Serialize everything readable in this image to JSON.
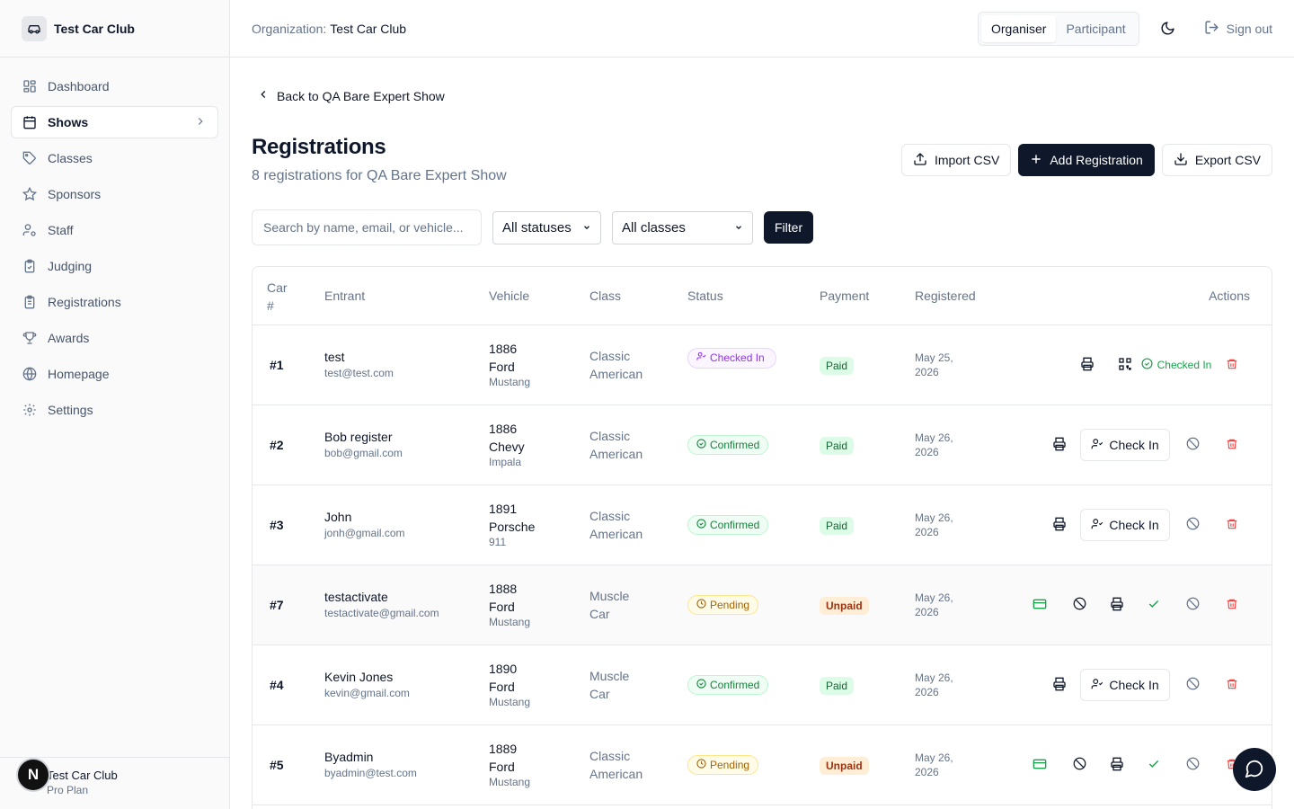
{
  "brand": {
    "name": "Test Car Club",
    "icon": "car-icon"
  },
  "sidebar": {
    "items": [
      {
        "label": "Dashboard",
        "icon": "dashboard-icon"
      },
      {
        "label": "Shows",
        "icon": "calendar-icon",
        "active": true
      },
      {
        "label": "Classes",
        "icon": "tag-icon"
      },
      {
        "label": "Sponsors",
        "icon": "star-icon"
      },
      {
        "label": "Staff",
        "icon": "user-cog-icon"
      },
      {
        "label": "Judging",
        "icon": "clipboard-check-icon"
      },
      {
        "label": "Registrations",
        "icon": "clipboard-list-icon"
      },
      {
        "label": "Awards",
        "icon": "trophy-icon"
      },
      {
        "label": "Homepage",
        "icon": "globe-icon"
      },
      {
        "label": "Settings",
        "icon": "gear-icon"
      }
    ],
    "footer": {
      "org": "Test Car Club",
      "plan": "Pro Plan",
      "avatar_letter": "N"
    }
  },
  "header": {
    "org_label": "Organization:",
    "org_value": "Test Car Club",
    "modes": [
      "Organiser",
      "Participant"
    ],
    "active_mode": "Organiser",
    "signout": "Sign out"
  },
  "page": {
    "back_label": "Back to QA Bare Expert Show",
    "title": "Registrations",
    "subtitle": "8 registrations for QA Bare Expert Show",
    "import_label": "Import CSV",
    "add_label": "Add Registration",
    "export_label": "Export CSV"
  },
  "filters": {
    "search_placeholder": "Search by name, email, or vehicle...",
    "status_value": "All statuses",
    "class_value": "All classes",
    "filter_label": "Filter"
  },
  "table": {
    "headers": {
      "car_line1": "Car",
      "car_line2": "#",
      "entrant": "Entrant",
      "vehicle": "Vehicle",
      "class": "Class",
      "status": "Status",
      "payment": "Payment",
      "registered": "Registered",
      "actions": "Actions"
    },
    "rows": [
      {
        "car": "#1",
        "name": "test",
        "email": "test@test.com",
        "year": "1886",
        "make": "Ford",
        "model": "Mustang",
        "class1": "Classic",
        "class2": "American",
        "status": "Checked In",
        "payment": "Paid",
        "date1": "May 25,",
        "date2": "2026",
        "checked_label": "Checked In"
      },
      {
        "car": "#2",
        "name": "Bob register",
        "email": "bob@gmail.com",
        "year": "1886",
        "make": "Chevy",
        "model": "Impala",
        "class1": "Classic",
        "class2": "American",
        "status": "Confirmed",
        "payment": "Paid",
        "date1": "May 26,",
        "date2": "2026",
        "checkin_label": "Check In"
      },
      {
        "car": "#3",
        "name": "John",
        "email": "jonh@gmail.com",
        "year": "1891",
        "make": "Porsche",
        "model": "911",
        "class1": "Classic",
        "class2": "American",
        "status": "Confirmed",
        "payment": "Paid",
        "date1": "May 26,",
        "date2": "2026",
        "checkin_label": "Check In"
      },
      {
        "car": "#7",
        "name": "testactivate",
        "email": "testactivate@gmail.com",
        "year": "1888",
        "make": "Ford",
        "model": "Mustang",
        "class1": "Muscle",
        "class2": "Car",
        "status": "Pending",
        "payment": "Unpaid",
        "date1": "May 26,",
        "date2": "2026"
      },
      {
        "car": "#4",
        "name": "Kevin Jones",
        "email": "kevin@gmail.com",
        "year": "1890",
        "make": "Ford",
        "model": "Mustang",
        "class1": "Muscle",
        "class2": "Car",
        "status": "Confirmed",
        "payment": "Paid",
        "date1": "May 26,",
        "date2": "2026",
        "checkin_label": "Check In"
      },
      {
        "car": "#5",
        "name": "Byadmin",
        "email": "byadmin@test.com",
        "year": "1889",
        "make": "Ford",
        "model": "Mustang",
        "class1": "Classic",
        "class2": "American",
        "status": "Pending",
        "payment": "Unpaid",
        "date1": "May 26,",
        "date2": "2026"
      }
    ]
  },
  "colors": {
    "primary": "#0f172a",
    "muted": "#64748b",
    "border": "#e5e7eb",
    "danger": "#ef4444",
    "success": "#16a34a"
  }
}
